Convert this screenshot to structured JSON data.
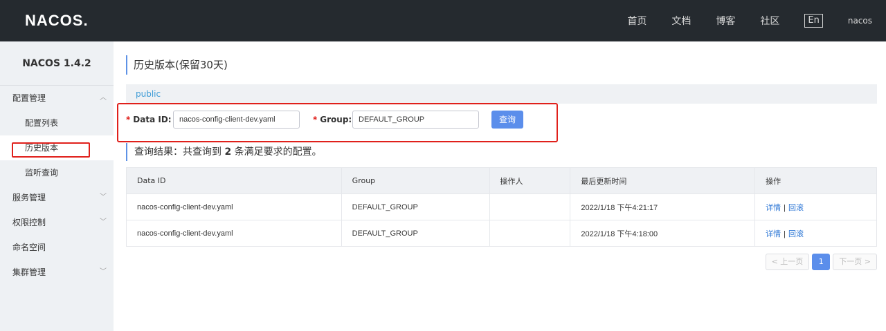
{
  "header": {
    "logo": "NACOS.",
    "nav": [
      "首页",
      "文档",
      "博客",
      "社区"
    ],
    "lang": "En",
    "user": "nacos"
  },
  "sidebar": {
    "version": "NACOS 1.4.2",
    "groups": [
      {
        "label": "配置管理",
        "expanded": true,
        "items": [
          "配置列表",
          "历史版本",
          "监听查询"
        ]
      },
      {
        "label": "服务管理",
        "expanded": false
      },
      {
        "label": "权限控制",
        "expanded": false
      },
      {
        "label": "命名空间"
      },
      {
        "label": "集群管理",
        "expanded": false
      }
    ],
    "active_item": "历史版本"
  },
  "main": {
    "title": "历史版本(保留30天)",
    "namespace": "public",
    "search": {
      "data_id_label": "Data ID:",
      "data_id_value": "nacos-config-client-dev.yaml",
      "group_label": "Group:",
      "group_value": "DEFAULT_GROUP",
      "query_button": "查询"
    },
    "result": {
      "prefix": "查询结果：共查询到 ",
      "count": "2",
      "suffix": " 条满足要求的配置。"
    },
    "table": {
      "columns": [
        "Data ID",
        "Group",
        "操作人",
        "最后更新时间",
        "操作"
      ],
      "rows": [
        {
          "data_id": "nacos-config-client-dev.yaml",
          "group": "DEFAULT_GROUP",
          "operator": "",
          "time": "2022/1/18 下午4:21:17",
          "action1": "详情",
          "action2": "回滚"
        },
        {
          "data_id": "nacos-config-client-dev.yaml",
          "group": "DEFAULT_GROUP",
          "operator": "",
          "time": "2022/1/18 下午4:18:00",
          "action1": "详情",
          "action2": "回滚"
        }
      ],
      "action_separator": "|"
    },
    "pagination": {
      "prev": "上一页",
      "current": "1",
      "next": "下一页"
    }
  },
  "colors": {
    "topbar": "#252a2f",
    "accent": "#5b8eeb",
    "highlight": "#e0201b",
    "link": "#2f78d6"
  }
}
